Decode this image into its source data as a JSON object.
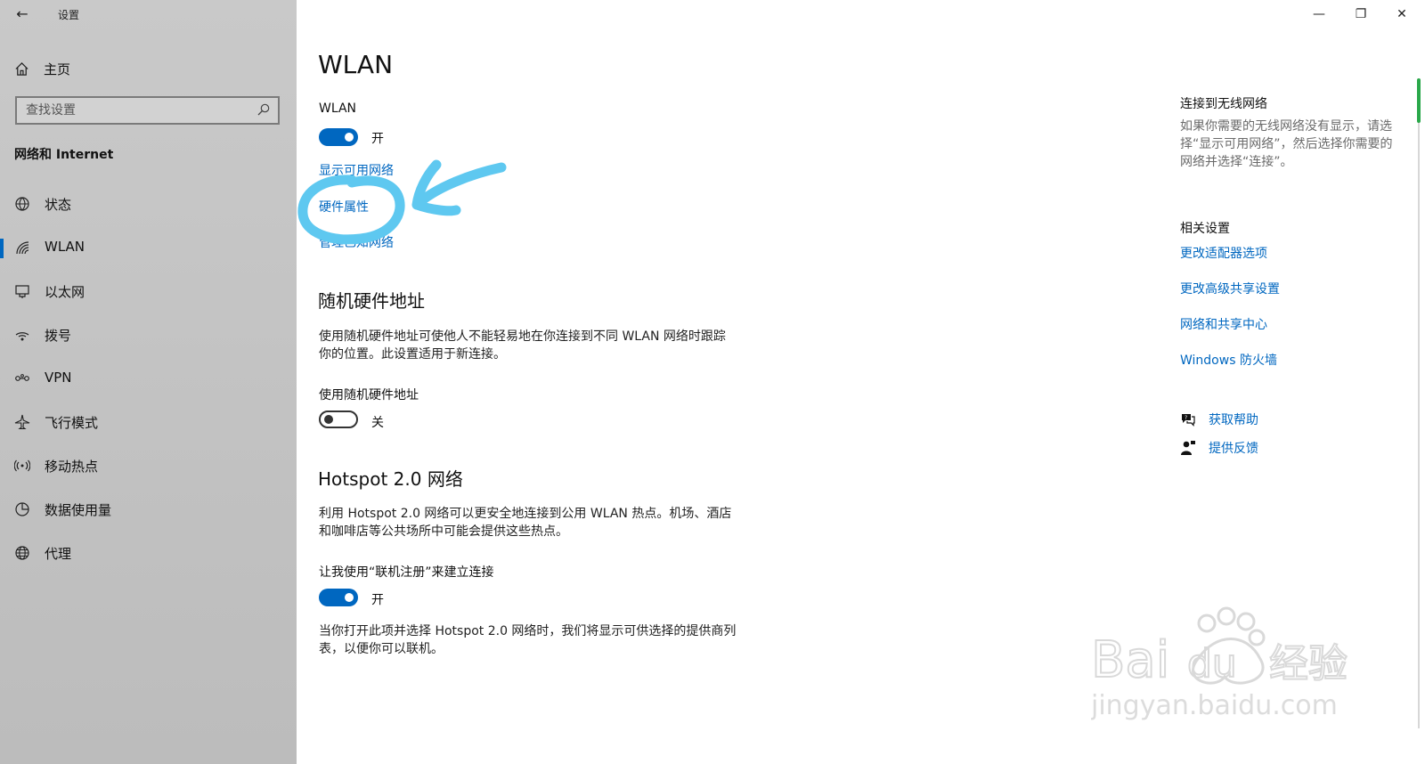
{
  "window": {
    "app_title": "设置",
    "controls": {
      "minimize": "—",
      "restore": "❐",
      "close": "✕"
    }
  },
  "sidebar": {
    "home_label": "主页",
    "search_placeholder": "查找设置",
    "section_title": "网络和 Internet",
    "items": [
      {
        "label": "状态",
        "icon": "globe-status-icon"
      },
      {
        "label": "WLAN",
        "icon": "wifi-icon",
        "active": true
      },
      {
        "label": "以太网",
        "icon": "ethernet-icon"
      },
      {
        "label": "拨号",
        "icon": "dialup-icon"
      },
      {
        "label": "VPN",
        "icon": "vpn-icon"
      },
      {
        "label": "飞行模式",
        "icon": "airplane-icon"
      },
      {
        "label": "移动热点",
        "icon": "hotspot-icon"
      },
      {
        "label": "数据使用量",
        "icon": "data-usage-icon"
      },
      {
        "label": "代理",
        "icon": "globe-icon"
      }
    ]
  },
  "main": {
    "title": "WLAN",
    "wlan_label": "WLAN",
    "wlan_toggle_state": "开",
    "links": [
      "显示可用网络",
      "硬件属性",
      "管理已知网络"
    ],
    "random_hw": {
      "heading": "随机硬件地址",
      "description": "使用随机硬件地址可使他人不能轻易地在你连接到不同 WLAN 网络时跟踪你的位置。此设置适用于新连接。",
      "toggle_label": "使用随机硬件地址",
      "toggle_state": "关"
    },
    "hotspot": {
      "heading": "Hotspot 2.0 网络",
      "description": "利用 Hotspot 2.0 网络可以更安全地连接到公用 WLAN 热点。机场、酒店和咖啡店等公共场所中可能会提供这些热点。",
      "toggle_label": "让我使用“联机注册”来建立连接",
      "toggle_state": "开",
      "footer": "当你打开此项并选择 Hotspot 2.0 网络时，我们将显示可供选择的提供商列表，以便你可以联机。"
    }
  },
  "right": {
    "connect_heading": "连接到无线网络",
    "connect_desc": "如果你需要的无线网络没有显示，请选择“显示可用网络”，然后选择你需要的网络并选择“连接”。",
    "related_heading": "相关设置",
    "related_links": [
      "更改适配器选项",
      "更改高级共享设置",
      "网络和共享中心",
      "Windows 防火墙"
    ],
    "help": "获取帮助",
    "feedback": "提供反馈"
  },
  "colors": {
    "accent": "#0067c0",
    "annotation": "#5ec8f0",
    "scroll_thumb": "#2aa84a"
  },
  "watermark": {
    "brand": "Bai du 经验",
    "url": "jingyan.baidu.com"
  }
}
